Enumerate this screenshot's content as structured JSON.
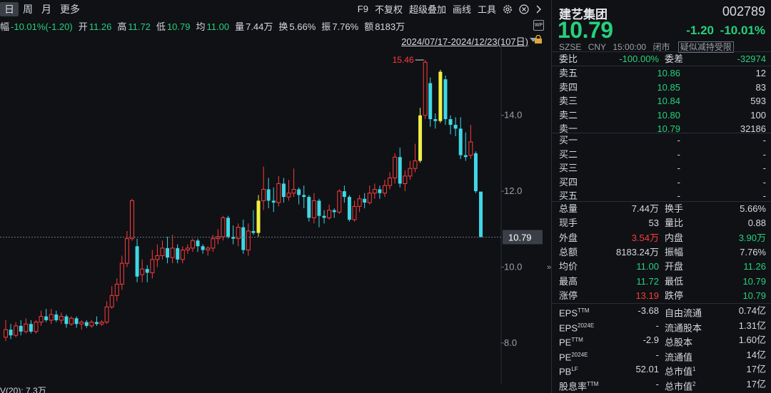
{
  "toolbar": {
    "periods": [
      "日",
      "周",
      "月",
      "更多"
    ],
    "active_period": "日",
    "tools": [
      "F9",
      "不复权",
      "超级叠加",
      "画线",
      "工具"
    ]
  },
  "quote_bar": [
    {
      "label": "幅",
      "value": "-10.01%(-1.20)",
      "color": "down"
    },
    {
      "label": "开",
      "value": "11.26",
      "color": "down"
    },
    {
      "label": "高",
      "value": "11.72",
      "color": "down"
    },
    {
      "label": "低",
      "value": "10.79",
      "color": "down"
    },
    {
      "label": "均",
      "value": "11.00",
      "color": "down"
    },
    {
      "label": "量",
      "value": "7.44万",
      "color": "plain"
    },
    {
      "label": "换",
      "value": "5.66%",
      "color": "plain"
    },
    {
      "label": "振",
      "value": "7.76%",
      "color": "plain"
    },
    {
      "label": "额",
      "value": "8183万",
      "color": "plain"
    }
  ],
  "range_text": "2024/07/17-2024/12/23(107日)",
  "wp_label": "WP",
  "chart_data": {
    "type": "candlestick",
    "y_ticks": [
      "14.0",
      "12.0",
      "10.0",
      "8.0"
    ],
    "y_tick_values": [
      14.0,
      12.0,
      10.0,
      8.0
    ],
    "ylim": [
      7.0,
      15.8
    ],
    "max_label": "15.46",
    "max_value": 15.46,
    "last_price_label": "10.79",
    "last_price": 10.79,
    "volume_label": "V(20): 7.3万",
    "candles": [
      [
        8.15,
        8.35,
        8.6,
        8.05
      ],
      [
        8.35,
        8.2,
        8.5,
        8.1
      ],
      [
        8.2,
        8.45,
        8.55,
        8.15
      ],
      [
        8.45,
        8.3,
        8.6,
        8.2
      ],
      [
        8.3,
        8.5,
        8.65,
        8.25
      ],
      [
        8.5,
        8.3,
        8.6,
        8.25
      ],
      [
        8.3,
        8.55,
        8.6,
        8.25
      ],
      [
        8.55,
        8.7,
        8.85,
        8.45
      ],
      [
        8.7,
        8.6,
        8.9,
        8.55
      ],
      [
        8.6,
        8.75,
        8.9,
        8.5
      ],
      [
        8.75,
        8.6,
        8.85,
        8.55
      ],
      [
        8.6,
        8.7,
        8.8,
        8.5
      ],
      [
        8.7,
        8.5,
        8.75,
        8.4
      ],
      [
        8.5,
        8.65,
        8.7,
        8.45
      ],
      [
        8.65,
        8.5,
        8.7,
        8.4
      ],
      [
        8.5,
        8.55,
        8.6,
        8.35
      ],
      [
        8.55,
        8.45,
        8.6,
        8.4
      ],
      [
        8.45,
        8.55,
        8.6,
        8.4
      ],
      [
        8.55,
        8.5,
        8.7,
        8.45
      ],
      [
        8.5,
        8.55,
        8.6,
        8.45
      ],
      [
        8.55,
        8.95,
        9.1,
        8.5
      ],
      [
        8.95,
        9.25,
        9.5,
        8.9
      ],
      [
        9.25,
        9.55,
        9.7,
        9.1
      ],
      [
        9.55,
        10.1,
        10.3,
        9.4
      ],
      [
        10.1,
        10.75,
        10.95,
        10.0
      ],
      [
        10.75,
        11.75,
        11.8,
        10.7
      ],
      [
        10.55,
        9.75,
        10.75,
        9.6
      ],
      [
        9.8,
        9.95,
        10.2,
        9.6
      ],
      [
        9.95,
        9.85,
        10.05,
        9.6
      ],
      [
        9.85,
        10.2,
        10.45,
        9.7
      ],
      [
        10.2,
        10.3,
        10.6,
        10.0
      ],
      [
        10.3,
        10.5,
        10.7,
        10.2
      ],
      [
        10.5,
        10.25,
        10.8,
        10.1
      ],
      [
        10.25,
        10.5,
        10.85,
        10.1
      ],
      [
        10.5,
        10.2,
        10.6,
        10.1
      ],
      [
        10.2,
        10.45,
        10.55,
        10.1
      ],
      [
        10.45,
        10.5,
        10.6,
        10.35
      ],
      [
        10.5,
        10.7,
        10.75,
        10.4
      ],
      [
        10.7,
        10.55,
        10.75,
        10.4
      ],
      [
        10.55,
        10.45,
        10.6,
        10.35
      ],
      [
        10.45,
        10.5,
        10.55,
        10.3
      ],
      [
        10.5,
        10.75,
        10.85,
        10.4
      ],
      [
        10.75,
        10.8,
        11.0,
        10.6
      ],
      [
        10.8,
        11.3,
        11.35,
        10.7
      ],
      [
        11.3,
        10.8,
        11.35,
        10.75
      ],
      [
        10.8,
        10.75,
        11.1,
        10.6
      ],
      [
        10.75,
        11.05,
        11.15,
        10.55
      ],
      [
        11.05,
        10.45,
        11.25,
        10.35
      ],
      [
        10.45,
        10.95,
        11.15,
        10.3
      ],
      [
        10.95,
        10.9,
        11.5,
        10.85
      ],
      [
        10.9,
        11.75,
        11.9,
        10.8
      ],
      [
        11.75,
        12.05,
        12.65,
        11.5
      ],
      [
        12.05,
        11.75,
        12.35,
        11.55
      ],
      [
        11.75,
        11.7,
        12.1,
        11.45
      ],
      [
        11.7,
        12.2,
        12.4,
        11.6
      ],
      [
        12.2,
        11.85,
        12.35,
        11.7
      ],
      [
        11.85,
        11.95,
        12.3,
        11.75
      ],
      [
        11.95,
        12.05,
        12.6,
        11.85
      ],
      [
        12.05,
        11.9,
        12.1,
        11.65
      ],
      [
        11.9,
        11.85,
        12.15,
        11.55
      ],
      [
        11.85,
        11.3,
        11.9,
        11.2
      ],
      [
        11.3,
        11.75,
        11.95,
        11.15
      ],
      [
        11.75,
        11.35,
        11.8,
        11.05
      ],
      [
        11.35,
        11.3,
        11.5,
        11.15
      ],
      [
        11.3,
        11.5,
        11.65,
        11.25
      ],
      [
        11.5,
        11.45,
        11.55,
        11.3
      ],
      [
        11.45,
        12.0,
        12.05,
        11.4
      ],
      [
        12.0,
        11.85,
        12.15,
        11.7
      ],
      [
        11.85,
        11.25,
        11.9,
        11.2
      ],
      [
        11.25,
        11.6,
        11.75,
        11.2
      ],
      [
        11.6,
        11.8,
        11.9,
        11.45
      ],
      [
        11.8,
        11.7,
        11.95,
        11.55
      ],
      [
        11.7,
        11.95,
        12.15,
        11.65
      ],
      [
        11.95,
        12.05,
        12.2,
        11.8
      ],
      [
        12.05,
        11.95,
        12.15,
        11.8
      ],
      [
        11.95,
        12.15,
        12.3,
        11.85
      ],
      [
        12.15,
        12.35,
        12.5,
        12.05
      ],
      [
        12.35,
        12.9,
        13.0,
        12.2
      ],
      [
        12.9,
        12.2,
        13.15,
        12.1
      ],
      [
        12.2,
        12.4,
        12.55,
        12.0
      ],
      [
        12.4,
        12.6,
        12.8,
        12.3
      ],
      [
        12.6,
        12.8,
        13.25,
        12.5
      ],
      [
        12.8,
        14.0,
        14.2,
        12.75
      ],
      [
        14.0,
        15.4,
        15.46,
        13.9
      ],
      [
        14.85,
        13.9,
        15.0,
        13.7
      ],
      [
        13.9,
        13.85,
        14.05,
        13.65
      ],
      [
        13.85,
        15.15,
        15.2,
        13.8
      ],
      [
        14.95,
        13.9,
        15.05,
        13.75
      ],
      [
        13.9,
        13.75,
        14.0,
        13.5
      ],
      [
        13.75,
        13.65,
        13.95,
        13.45
      ],
      [
        13.65,
        12.95,
        13.95,
        12.85
      ],
      [
        12.95,
        12.9,
        13.55,
        12.8
      ],
      [
        12.95,
        13.3,
        13.75,
        12.85
      ],
      [
        13.0,
        12.0,
        13.05,
        11.95
      ],
      [
        11.99,
        10.79,
        11.72,
        10.79
      ]
    ],
    "bull_flags": [
      0,
      0,
      0,
      0,
      0,
      0,
      0,
      0,
      0,
      0,
      0,
      0,
      0,
      0,
      0,
      0,
      0,
      0,
      0,
      0,
      0,
      0,
      0,
      0,
      0,
      0,
      0,
      0,
      0,
      0,
      0,
      0,
      0,
      0,
      0,
      0,
      0,
      0,
      0,
      0,
      0,
      0,
      0,
      0,
      0,
      0,
      0,
      0,
      0,
      0,
      1,
      0,
      0,
      0,
      0,
      0,
      0,
      0,
      0,
      0,
      0,
      0,
      0,
      0,
      0,
      0,
      0,
      0,
      0,
      0,
      0,
      0,
      0,
      0,
      0,
      0,
      0,
      0,
      0,
      0,
      0,
      0,
      1,
      0,
      0,
      0,
      1,
      0,
      0,
      0,
      0,
      0,
      0,
      0,
      0
    ]
  },
  "info": {
    "name": "建艺集团",
    "code": "002789",
    "price": "10.79",
    "change_abs": "-1.20",
    "change_pct": "-10.01%",
    "meta": [
      "SZSE",
      "CNY",
      "15:00:00",
      "闭市",
      "疑似减持受限"
    ],
    "weibi": {
      "label1": "委比",
      "value1": "-100.00%",
      "label2": "委差",
      "value2": "-32974"
    },
    "asks": [
      {
        "label": "卖五",
        "price": "10.86",
        "vol": "12"
      },
      {
        "label": "卖四",
        "price": "10.85",
        "vol": "83"
      },
      {
        "label": "卖三",
        "price": "10.84",
        "vol": "593"
      },
      {
        "label": "卖二",
        "price": "10.80",
        "vol": "100"
      },
      {
        "label": "卖一",
        "price": "10.79",
        "vol": "32186"
      }
    ],
    "bids": [
      {
        "label": "买一",
        "price": "-",
        "vol": "-"
      },
      {
        "label": "买二",
        "price": "-",
        "vol": "-"
      },
      {
        "label": "买三",
        "price": "-",
        "vol": "-"
      },
      {
        "label": "买四",
        "price": "-",
        "vol": "-"
      },
      {
        "label": "买五",
        "price": "-",
        "vol": "-"
      }
    ],
    "stats": [
      {
        "l1": "总量",
        "v1": "7.44万",
        "c1": "plain",
        "l2": "换手",
        "v2": "5.66%",
        "c2": "plain"
      },
      {
        "l1": "现手",
        "v1": "53",
        "c1": "plain",
        "l2": "量比",
        "v2": "0.88",
        "c2": "plain"
      },
      {
        "l1": "外盘",
        "v1": "3.54万",
        "c1": "up",
        "l2": "内盘",
        "v2": "3.90万",
        "c2": "down"
      },
      {
        "l1": "总额",
        "v1": "8183.24万",
        "c1": "plain",
        "l2": "振幅",
        "v2": "7.76%",
        "c2": "plain"
      },
      {
        "l1": "均价",
        "v1": "11.00",
        "c1": "down",
        "l2": "开盘",
        "v2": "11.26",
        "c2": "down"
      },
      {
        "l1": "最高",
        "v1": "11.72",
        "c1": "down",
        "l2": "最低",
        "v2": "10.79",
        "c2": "down"
      },
      {
        "l1": "涨停",
        "v1": "13.19",
        "c1": "up",
        "l2": "跌停",
        "v2": "10.79",
        "c2": "down"
      }
    ],
    "fundamentals": [
      {
        "l1": "EPS",
        "s1": "TTM",
        "v1": "-3.68",
        "l2": "自由流通",
        "s2": "",
        "v2": "0.74亿"
      },
      {
        "l1": "EPS",
        "s1": "2024E",
        "v1": "-",
        "l2": "流通股本",
        "s2": "",
        "v2": "1.31亿"
      },
      {
        "l1": "PE",
        "s1": "TTM",
        "v1": "-2.9",
        "l2": "总股本",
        "s2": "",
        "v2": "1.60亿"
      },
      {
        "l1": "PE",
        "s1": "2024E",
        "v1": "-",
        "l2": "流通值",
        "s2": "",
        "v2": "14亿"
      },
      {
        "l1": "PB",
        "s1": "LF",
        "v1": "52.01",
        "l2": "总市值",
        "s2": "1",
        "v2": "17亿"
      },
      {
        "l1": "股息率",
        "s1": "TTM",
        "v1": "-",
        "l2": "总市值",
        "s2": "2",
        "v2": "17亿"
      }
    ]
  },
  "colors": {
    "up": "#ff3b3b",
    "down": "#26d07c",
    "highlight": "#f0f043",
    "bear_candle": "#3fd7e6"
  }
}
